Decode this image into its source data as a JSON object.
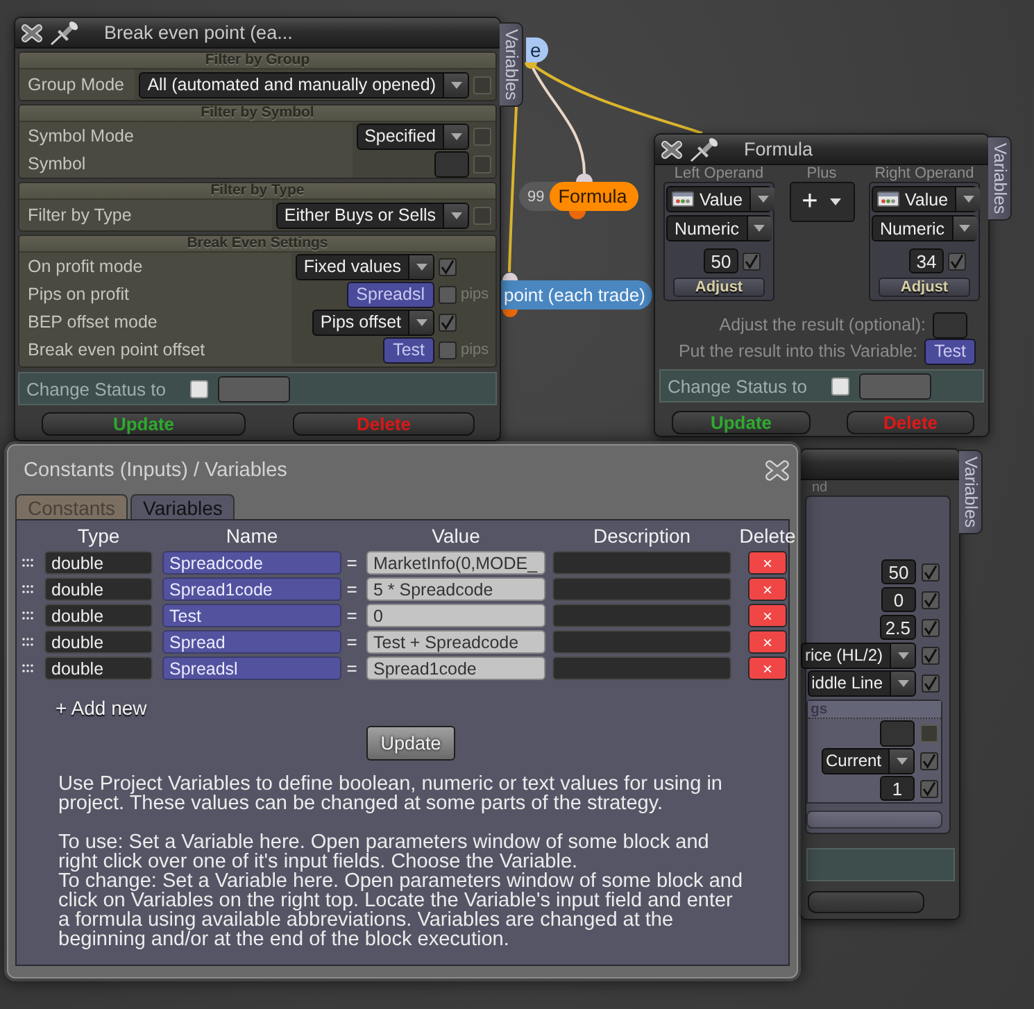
{
  "canvas_nodes": [
    {
      "kind": "variable",
      "label": "e"
    },
    {
      "kind": "formula",
      "count": "99",
      "label": "Formula"
    },
    {
      "kind": "action",
      "label": "point (each trade)"
    }
  ],
  "break_even_window": {
    "title": "Break even point (ea...",
    "side_tab": "Variables",
    "sections": [
      {
        "header": "Filter by Group",
        "rows": [
          {
            "label": "Group Mode",
            "kind": "select",
            "value": "All (automated and manually opened)",
            "checked": false,
            "enabled": false
          }
        ]
      },
      {
        "header": "Filter by Symbol",
        "rows": [
          {
            "label": "Symbol Mode",
            "kind": "select",
            "value": "Specified",
            "checked": false,
            "enabled": false
          },
          {
            "label": "Symbol",
            "kind": "input",
            "checked": false,
            "enabled": false
          }
        ]
      },
      {
        "header": "Filter by Type",
        "rows": [
          {
            "label": "Filter by Type",
            "kind": "select",
            "value": "Either Buys or Sells",
            "checked": false,
            "enabled": false
          }
        ]
      },
      {
        "header": "Break Even Settings",
        "rows": [
          {
            "label": "On profit mode",
            "kind": "select",
            "value": "Fixed values",
            "checked": true,
            "enabled": true
          },
          {
            "label": "Pips on profit",
            "kind": "variable",
            "value": "Spreadsl",
            "checked": false,
            "enabled": true,
            "unit": "pips"
          },
          {
            "label": "BEP offset mode",
            "kind": "select",
            "value": "Pips offset",
            "checked": true,
            "enabled": true
          },
          {
            "label": "Break even point offset",
            "kind": "variable",
            "value": "Test",
            "checked": false,
            "enabled": true,
            "unit": "pips"
          }
        ]
      }
    ],
    "change_status": {
      "label": "Change Status to",
      "checked": false
    },
    "buttons": [
      {
        "kind": "update",
        "label": "Update"
      },
      {
        "kind": "delete",
        "label": "Delete"
      }
    ]
  },
  "formula_window": {
    "title": "Formula",
    "side_tab": "Variables",
    "operands": [
      {
        "heading": "Left Operand",
        "source": "Value",
        "type": "Numeric",
        "value": "50",
        "checked": true,
        "button": "Adjust"
      },
      {
        "heading": "Right Operand",
        "source": "Value",
        "type": "Numeric",
        "value": "34",
        "checked": true,
        "button": "Adjust"
      }
    ],
    "operator": {
      "heading": "Plus",
      "symbol": "+"
    },
    "adjust_result": {
      "label": "Adjust the result (optional):"
    },
    "result_variable": {
      "label": "Put the result into this Variable:",
      "value": "Test"
    },
    "change_status": {
      "label": "Change Status to",
      "checked": false
    },
    "buttons": [
      {
        "kind": "update",
        "label": "Update"
      },
      {
        "kind": "delete",
        "label": "Delete"
      }
    ]
  },
  "background_window": {
    "side_tab": "Variables",
    "section_header": "nd",
    "rows": [
      {
        "kind": "input",
        "value": "50",
        "checked": true,
        "enabled": true
      },
      {
        "kind": "input",
        "value": "0",
        "checked": true,
        "enabled": true
      },
      {
        "kind": "input",
        "value": "2.5",
        "checked": true,
        "enabled": true
      },
      {
        "kind": "select",
        "value": "rice (HL/2)",
        "checked": true,
        "enabled": true
      },
      {
        "kind": "select",
        "value": "iddle Line",
        "checked": true,
        "enabled": true
      }
    ],
    "subsection": {
      "header": "gs",
      "rows": [
        {
          "kind": "input",
          "checked": false,
          "enabled": false
        },
        {
          "kind": "select",
          "value": "Current",
          "checked": true,
          "enabled": true
        },
        {
          "kind": "input",
          "value": "1",
          "checked": true,
          "enabled": true
        }
      ]
    }
  },
  "variables_dialog": {
    "title": "Constants (Inputs) / Variables",
    "tabs": [
      {
        "label": "Constants",
        "selected": false
      },
      {
        "label": "Variables",
        "selected": true
      }
    ],
    "table": {
      "columns": [
        "Type",
        "Name",
        "Value",
        "Description",
        "Delete"
      ],
      "rows": [
        {
          "type": "double",
          "name": "Spreadcode",
          "operator": "=",
          "value": "MarketInfo(0,MODE_",
          "delete": "×"
        },
        {
          "type": "double",
          "name": "Spread1code",
          "operator": "=",
          "value": "5 * Spreadcode",
          "delete": "×"
        },
        {
          "type": "double",
          "name": "Test",
          "operator": "=",
          "value": "0",
          "delete": "×"
        },
        {
          "type": "double",
          "name": "Spread",
          "operator": "=",
          "value": "Test + Spreadcode",
          "delete": "×"
        },
        {
          "type": "double",
          "name": "Spreadsl",
          "operator": "=",
          "value": "Spread1code",
          "delete": "×"
        }
      ]
    },
    "add_new": "+ Add new",
    "update_button": "Update",
    "help": [
      {
        "paragraphs": [
          "Use Project Variables to define boolean, numeric or text values for using in project. These values can be changed at some parts of the strategy."
        ]
      },
      {
        "paragraphs": [
          "To use: Set a Variable here. Open parameters window of some block and right click over one of it's input fields. Choose the Variable.",
          "To change: Set a Variable here. Open parameters window of some block and click on Variables on the right top. Locate the Variable's input field and enter a formula using available abbreviations. Variables are changed at the beginning and/or at the end of the block execution."
        ]
      }
    ]
  }
}
